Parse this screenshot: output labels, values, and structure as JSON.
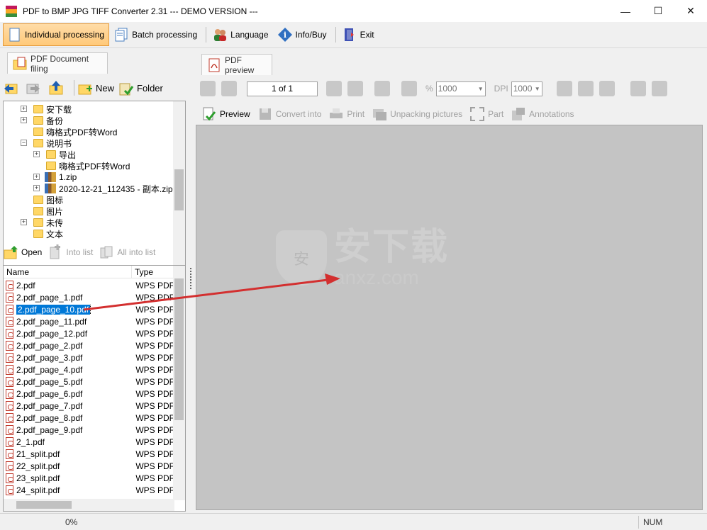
{
  "window": {
    "title": "PDF to BMP JPG TIFF Converter 2.31 --- DEMO VERSION ---",
    "minimize": "—",
    "maximize": "☐",
    "close": "✕"
  },
  "toolbar": {
    "individual": "Individual processing",
    "batch": "Batch processing",
    "language": "Language",
    "info": "Info/Buy",
    "exit": "Exit"
  },
  "left": {
    "tab": "PDF Document filing",
    "nav": {
      "new": "New",
      "folder": "Folder"
    },
    "tree": [
      {
        "label": "安下载",
        "type": "folder",
        "expander": "+"
      },
      {
        "label": "备份",
        "type": "folder",
        "expander": "+"
      },
      {
        "label": "嗨格式PDF转Word",
        "type": "folder",
        "expander": ""
      },
      {
        "label": "说明书",
        "type": "folder",
        "expander": "−"
      },
      {
        "label": "导出",
        "type": "folder",
        "expander": "+"
      },
      {
        "label": "嗨格式PDF转Word",
        "type": "folder",
        "expander": ""
      },
      {
        "label": "1.zip",
        "type": "zip",
        "expander": "+"
      },
      {
        "label": "2020-12-21_112435 - 副本.zip",
        "type": "zip",
        "expander": "+"
      },
      {
        "label": "图标",
        "type": "folder",
        "expander": ""
      },
      {
        "label": "图片",
        "type": "folder",
        "expander": ""
      },
      {
        "label": "未传",
        "type": "folder",
        "expander": "+"
      },
      {
        "label": "文本",
        "type": "folder",
        "expander": ""
      }
    ],
    "filetb": {
      "open": "Open",
      "into_list": "Into list",
      "all_into_list": "All into list"
    },
    "columns": {
      "name": "Name",
      "type": "Type"
    },
    "files": [
      {
        "name": "2.pdf",
        "type": "WPS PDF"
      },
      {
        "name": "2.pdf_page_1.pdf",
        "type": "WPS PDF"
      },
      {
        "name": "2.pdf_page_10.pdf",
        "type": "WPS PDF"
      },
      {
        "name": "2.pdf_page_11.pdf",
        "type": "WPS PDF"
      },
      {
        "name": "2.pdf_page_12.pdf",
        "type": "WPS PDF"
      },
      {
        "name": "2.pdf_page_2.pdf",
        "type": "WPS PDF"
      },
      {
        "name": "2.pdf_page_3.pdf",
        "type": "WPS PDF"
      },
      {
        "name": "2.pdf_page_4.pdf",
        "type": "WPS PDF"
      },
      {
        "name": "2.pdf_page_5.pdf",
        "type": "WPS PDF"
      },
      {
        "name": "2.pdf_page_6.pdf",
        "type": "WPS PDF"
      },
      {
        "name": "2.pdf_page_7.pdf",
        "type": "WPS PDF"
      },
      {
        "name": "2.pdf_page_8.pdf",
        "type": "WPS PDF"
      },
      {
        "name": "2.pdf_page_9.pdf",
        "type": "WPS PDF"
      },
      {
        "name": "2_1.pdf",
        "type": "WPS PDF"
      },
      {
        "name": "21_split.pdf",
        "type": "WPS PDF"
      },
      {
        "name": "22_split.pdf",
        "type": "WPS PDF"
      },
      {
        "name": "23_split.pdf",
        "type": "WPS PDF"
      },
      {
        "name": "24_split.pdf",
        "type": "WPS PDF"
      }
    ],
    "selected_file": "2.pdf_page_10.pdf"
  },
  "preview": {
    "tab": "PDF preview",
    "page": "1 of 1",
    "zoom_label": "%",
    "zoom": "1000",
    "dpi_label": "DPI",
    "dpi": "1000",
    "actions": {
      "preview": "Preview",
      "convert": "Convert into",
      "print": "Print",
      "unpacking": "Unpacking pictures",
      "part": "Part",
      "annotations": "Annotations"
    },
    "watermark_big": "安下载",
    "watermark_small": "anxz.com",
    "watermark_badge": "安"
  },
  "status": {
    "progress": "0%",
    "num": "NUM"
  },
  "colors": {
    "accent": "#0078d7",
    "arrow": "#d32f2f",
    "canvas": "#c4c4c4"
  }
}
